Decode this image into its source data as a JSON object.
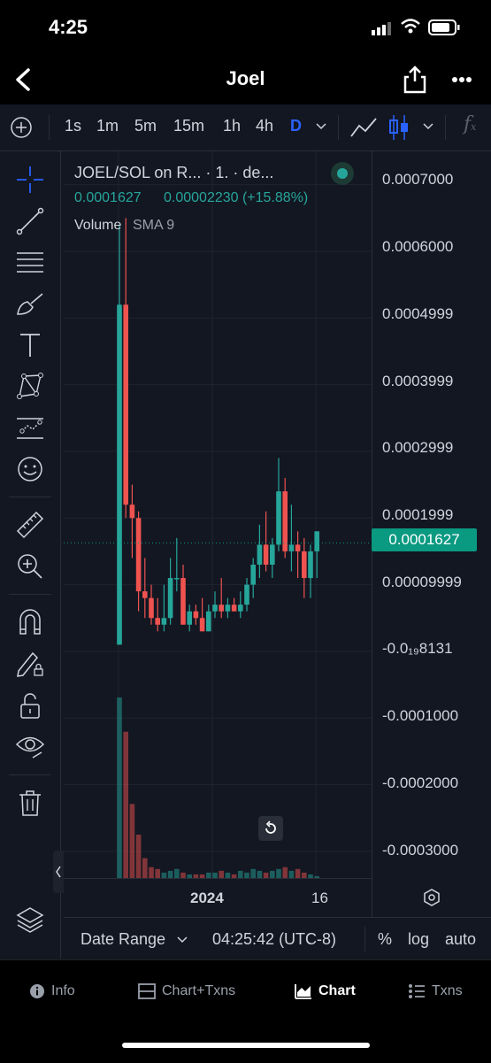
{
  "status": {
    "time": "4:25"
  },
  "nav": {
    "title": "Joel"
  },
  "timeframes": [
    "1s",
    "1m",
    "5m",
    "15m",
    "1h",
    "4h",
    "D"
  ],
  "active_timeframe": "D",
  "legend": {
    "pair": "JOEL/SOL on R... · 1. · de...",
    "price": "0.0001627",
    "change": "0.00002230 (+15.88%)",
    "volume_label": "Volume",
    "volume_sma": "SMA 9"
  },
  "price_axis": {
    "labels": [
      "0.0007000",
      "0.0006000",
      "0.0004999",
      "0.0003999",
      "0.0002999",
      "0.0001999",
      "0.00009999",
      "-0.0₁₉8131",
      "-0.0001000",
      "-0.0002000",
      "-0.0003000"
    ],
    "current": "0.0001627"
  },
  "time_axis": {
    "year": "2024",
    "day": "16"
  },
  "bottom": {
    "date_range": "Date Range",
    "clock": "04:25:42 (UTC-8)",
    "percent": "%",
    "log": "log",
    "auto": "auto"
  },
  "tabs": [
    "Info",
    "Chart+Txns",
    "Chart",
    "Txns"
  ],
  "active_tab": "Chart",
  "colors": {
    "up": "#26a69a",
    "down": "#ef5350",
    "accent": "#2962ff",
    "price_tag": "#0a9981"
  },
  "chart_data": {
    "type": "candlestick",
    "ylim": [
      -0.00034,
      0.00075
    ],
    "candles": [
      {
        "o": 1e-05,
        "h": 0.00064,
        "l": 1e-05,
        "c": 0.00052
      },
      {
        "o": 0.00052,
        "h": 0.00065,
        "l": 0.0002,
        "c": 0.00022
      },
      {
        "o": 0.00022,
        "h": 0.00025,
        "l": 0.00014,
        "c": 0.0002
      },
      {
        "o": 0.0002,
        "h": 0.00021,
        "l": 6e-05,
        "c": 9e-05
      },
      {
        "o": 9e-05,
        "h": 0.00014,
        "l": 5e-05,
        "c": 8e-05
      },
      {
        "o": 8e-05,
        "h": 0.0001,
        "l": 4e-05,
        "c": 5e-05
      },
      {
        "o": 5e-05,
        "h": 8e-05,
        "l": 3e-05,
        "c": 4e-05
      },
      {
        "o": 4e-05,
        "h": 0.0001,
        "l": 3e-05,
        "c": 5e-05
      },
      {
        "o": 5e-05,
        "h": 0.00014,
        "l": 4e-05,
        "c": 0.00011
      },
      {
        "o": 0.00011,
        "h": 0.00017,
        "l": 9e-05,
        "c": 0.00011
      },
      {
        "o": 0.00011,
        "h": 0.00013,
        "l": 4e-05,
        "c": 4e-05
      },
      {
        "o": 4e-05,
        "h": 7e-05,
        "l": 3e-05,
        "c": 6e-05
      },
      {
        "o": 6e-05,
        "h": 7e-05,
        "l": 4e-05,
        "c": 5e-05
      },
      {
        "o": 5e-05,
        "h": 8e-05,
        "l": 3e-05,
        "c": 3e-05
      },
      {
        "o": 3e-05,
        "h": 7e-05,
        "l": 3e-05,
        "c": 6e-05
      },
      {
        "o": 6e-05,
        "h": 9e-05,
        "l": 5e-05,
        "c": 7e-05
      },
      {
        "o": 7e-05,
        "h": 0.00011,
        "l": 5e-05,
        "c": 6e-05
      },
      {
        "o": 6e-05,
        "h": 8e-05,
        "l": 5e-05,
        "c": 7e-05
      },
      {
        "o": 7e-05,
        "h": 8e-05,
        "l": 6e-05,
        "c": 6e-05
      },
      {
        "o": 6e-05,
        "h": 9e-05,
        "l": 5e-05,
        "c": 7e-05
      },
      {
        "o": 7e-05,
        "h": 0.00011,
        "l": 6e-05,
        "c": 0.0001
      },
      {
        "o": 0.0001,
        "h": 0.00014,
        "l": 8e-05,
        "c": 0.00013
      },
      {
        "o": 0.00013,
        "h": 0.00019,
        "l": 0.00011,
        "c": 0.00016
      },
      {
        "o": 0.00016,
        "h": 0.00021,
        "l": 0.00012,
        "c": 0.00013
      },
      {
        "o": 0.00013,
        "h": 0.00017,
        "l": 0.00011,
        "c": 0.00016
      },
      {
        "o": 0.00016,
        "h": 0.00029,
        "l": 0.00015,
        "c": 0.00024
      },
      {
        "o": 0.00024,
        "h": 0.00026,
        "l": 0.00014,
        "c": 0.00015
      },
      {
        "o": 0.00015,
        "h": 0.00022,
        "l": 0.00012,
        "c": 0.00016
      },
      {
        "o": 0.00016,
        "h": 0.00018,
        "l": 0.00011,
        "c": 0.00015
      },
      {
        "o": 0.00015,
        "h": 0.00017,
        "l": 8e-05,
        "c": 0.00011
      },
      {
        "o": 0.00011,
        "h": 0.00016,
        "l": 8e-05,
        "c": 0.00015
      },
      {
        "o": 0.00015,
        "h": 0.00018,
        "l": 0.00011,
        "c": 0.00018
      }
    ],
    "volumes": [
      1.0,
      0.81,
      0.41,
      0.24,
      0.11,
      0.06,
      0.05,
      0.03,
      0.04,
      0.05,
      0.03,
      0.02,
      0.02,
      0.02,
      0.03,
      0.03,
      0.04,
      0.03,
      0.02,
      0.04,
      0.03,
      0.05,
      0.04,
      0.03,
      0.04,
      0.05,
      0.06,
      0.04,
      0.05,
      0.03,
      0.02,
      0.01
    ]
  }
}
